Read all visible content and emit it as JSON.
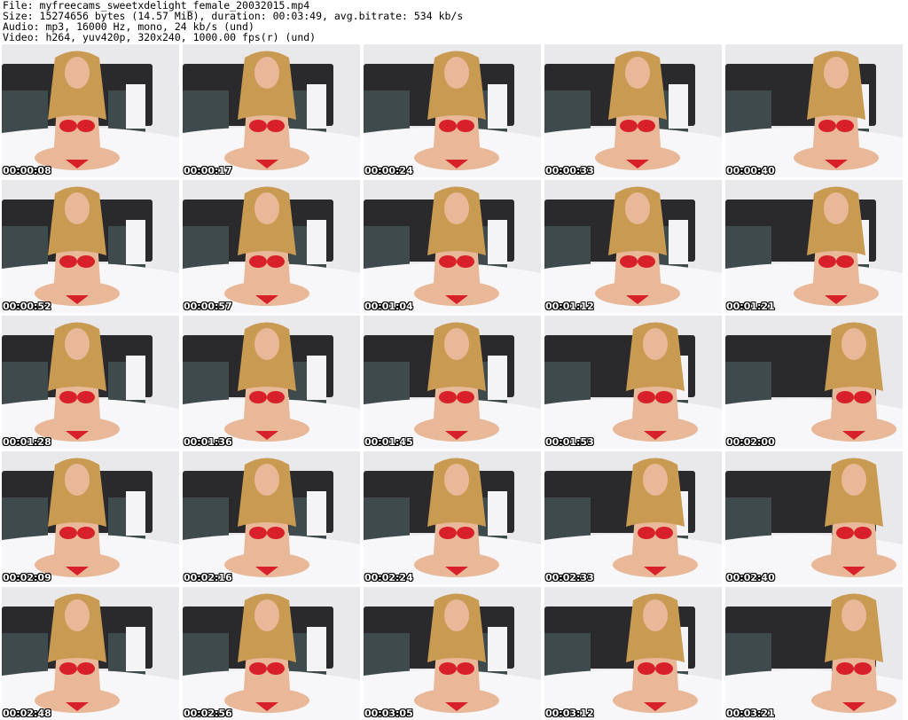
{
  "header": {
    "file": "File: myfreecams_sweetxdelight_female_20032015.mp4",
    "size": "Size: 15274656 bytes (14.57 MiB), duration: 00:03:49, avg.bitrate: 534 kb/s",
    "audio": "Audio: mp3, 16000 Hz, mono, 24 kb/s (und)",
    "video": "Video: h264, yuv420p, 320x240, 1000.00 fps(r) (und)"
  },
  "colors": {
    "wall": "#e9e9ec",
    "headboard": "#2a2a2c",
    "pillow_dark": "#3f4a4c",
    "pillow_white": "#f4f4f6",
    "sheet": "#f7f7f9",
    "skin": "#e9b899",
    "hair": "#c99a52",
    "lingerie": "#d8202a"
  },
  "thumbnails": [
    {
      "time": "00:00:08"
    },
    {
      "time": "00:00:17"
    },
    {
      "time": "00:00:24"
    },
    {
      "time": "00:00:33"
    },
    {
      "time": "00:00:40"
    },
    {
      "time": "00:00:52"
    },
    {
      "time": "00:00:57"
    },
    {
      "time": "00:01:04"
    },
    {
      "time": "00:01:12"
    },
    {
      "time": "00:01:21"
    },
    {
      "time": "00:01:28"
    },
    {
      "time": "00:01:36"
    },
    {
      "time": "00:01:45"
    },
    {
      "time": "00:01:53"
    },
    {
      "time": "00:02:00"
    },
    {
      "time": "00:02:09"
    },
    {
      "time": "00:02:16"
    },
    {
      "time": "00:02:24"
    },
    {
      "time": "00:02:33"
    },
    {
      "time": "00:02:40"
    },
    {
      "time": "00:02:48"
    },
    {
      "time": "00:02:56"
    },
    {
      "time": "00:03:05"
    },
    {
      "time": "00:03:12"
    },
    {
      "time": "00:03:21"
    }
  ]
}
